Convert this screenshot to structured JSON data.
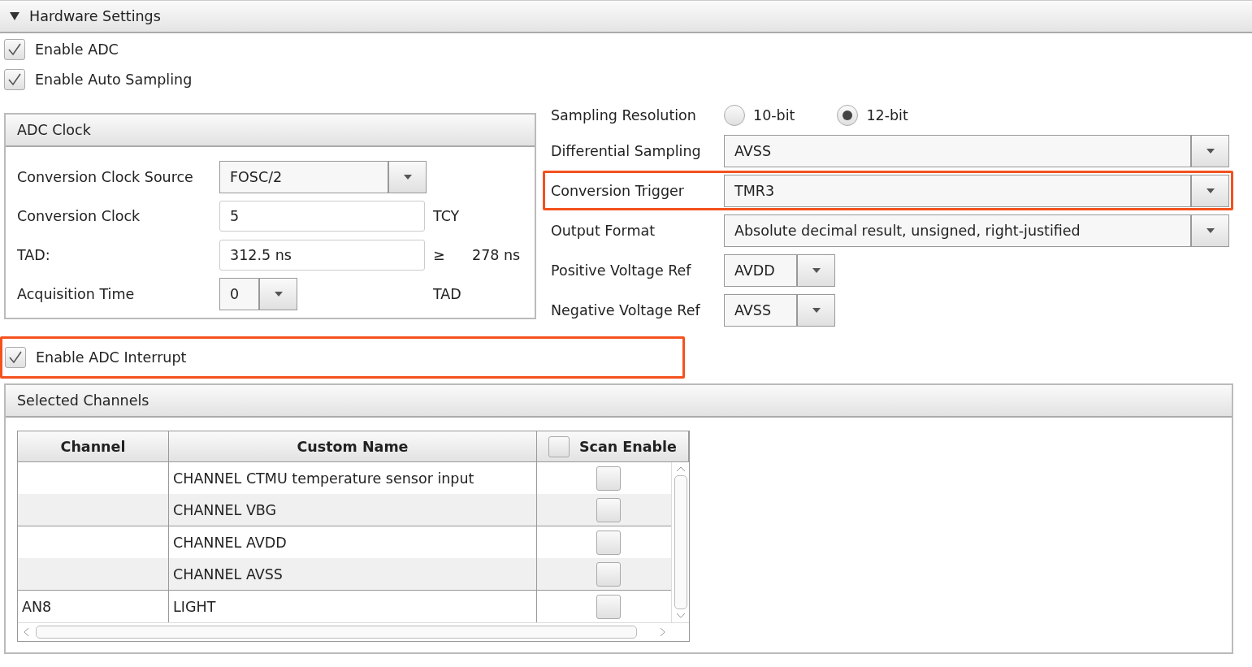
{
  "section": {
    "title": "Hardware Settings",
    "expanded": true
  },
  "options": [
    {
      "label": "Enable ADC",
      "checked": true
    },
    {
      "label": "Enable Auto Sampling",
      "checked": true
    }
  ],
  "adc_clock": {
    "title": "ADC Clock",
    "rows": [
      {
        "kind": "select",
        "label": "Conversion Clock Source",
        "value": "FOSC/2"
      },
      {
        "kind": "text",
        "label": "Conversion Clock",
        "value": "5",
        "unit": "TCY"
      },
      {
        "kind": "text",
        "label": "TAD:",
        "value": "312.5 ns",
        "unit": "≥",
        "extra": "278 ns"
      },
      {
        "kind": "spinner",
        "label": "Acquisition Time",
        "value": "0",
        "unit": "TAD"
      }
    ]
  },
  "sampling_resolution": {
    "label": "Sampling Resolution",
    "options": [
      {
        "label": "10-bit",
        "selected": false
      },
      {
        "label": "12-bit",
        "selected": true
      }
    ]
  },
  "fields": [
    {
      "kind": "wide",
      "label": "Differential Sampling",
      "value": "AVSS",
      "highlighted": false
    },
    {
      "kind": "wide",
      "label": "Conversion Trigger",
      "value": "TMR3",
      "highlighted": true
    },
    {
      "kind": "wide",
      "label": "Output Format",
      "value": "Absolute decimal result, unsigned, right-justified",
      "highlighted": false
    },
    {
      "kind": "narrow",
      "label": "Positive Voltage Ref",
      "value": "AVDD",
      "highlighted": false
    },
    {
      "kind": "narrow",
      "label": "Negative Voltage Ref",
      "value": "AVSS",
      "highlighted": false
    }
  ],
  "interrupt": {
    "label": "Enable ADC Interrupt",
    "checked": true,
    "highlighted": true
  },
  "selected_channels": {
    "title": "Selected Channels",
    "columns": [
      {
        "label": "Channel"
      },
      {
        "label": "Custom Name"
      },
      {
        "label": "Scan Enable",
        "checked": false
      }
    ],
    "rows": [
      {
        "name": "CHANNEL CTMU temperature sensor input",
        "scan_enable": false
      },
      {
        "name": "CHANNEL VBG",
        "scan_enable": false
      },
      {
        "name": "CHANNEL AVDD",
        "scan_enable": false
      },
      {
        "name": "CHANNEL AVSS",
        "scan_enable": false
      },
      {
        "channel": "AN8",
        "name": "LIGHT",
        "scan_enable": false
      }
    ]
  }
}
